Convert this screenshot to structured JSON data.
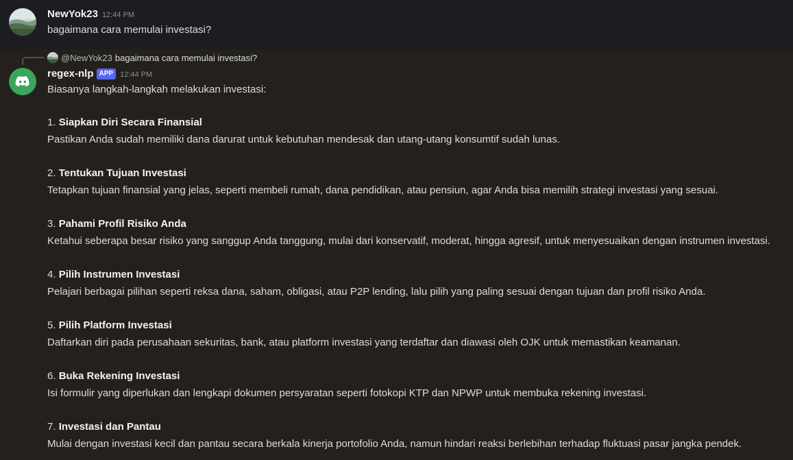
{
  "first_message": {
    "author": "NewYok23",
    "timestamp": "12:44 PM",
    "content": "bagaimana cara memulai investasi?",
    "avatar_icon": "landscape-avatar-icon"
  },
  "reply_preview": {
    "mention": "@NewYok23",
    "content": "bagaimana cara memulai investasi?"
  },
  "bot_message": {
    "author": "regex-nlp",
    "badge": "APP",
    "timestamp": "12:44 PM",
    "avatar_icon": "discord-logo-icon",
    "intro": "Biasanya langkah-langkah melakukan investasi:",
    "steps": [
      {
        "number": "1.",
        "title": "Siapkan Diri Secara Finansial",
        "desc": "Pastikan Anda sudah memiliki dana darurat untuk kebutuhan mendesak dan utang-utang konsumtif sudah lunas."
      },
      {
        "number": "2.",
        "title": "Tentukan Tujuan Investasi",
        "desc": "Tetapkan tujuan finansial yang jelas, seperti membeli rumah, dana pendidikan, atau pensiun, agar Anda bisa memilih strategi investasi yang sesuai."
      },
      {
        "number": "3.",
        "title": "Pahami Profil Risiko Anda",
        "desc": "Ketahui seberapa besar risiko yang sanggup Anda tanggung, mulai dari konservatif, moderat, hingga agresif, untuk menyesuaikan dengan instrumen investasi."
      },
      {
        "number": "4.",
        "title": "Pilih Instrumen Investasi",
        "desc": "Pelajari berbagai pilihan seperti reksa dana, saham, obligasi, atau P2P lending, lalu pilih yang paling sesuai dengan tujuan dan profil risiko Anda."
      },
      {
        "number": "5.",
        "title": "Pilih Platform Investasi",
        "desc": "Daftarkan diri pada perusahaan sekuritas, bank, atau platform investasi yang terdaftar dan diawasi oleh OJK untuk memastikan keamanan."
      },
      {
        "number": "6.",
        "title": "Buka Rekening Investasi",
        "desc": "Isi formulir yang diperlukan dan lengkapi dokumen persyaratan seperti fotokopi KTP dan NPWP untuk membuka rekening investasi."
      },
      {
        "number": "7.",
        "title": "Investasi dan Pantau",
        "desc": "Mulai dengan investasi kecil dan pantau secara berkala kinerja portofolio Anda, namun hindari reaksi berlebihan terhadap fluktuasi pasar jangka pendek."
      }
    ]
  }
}
